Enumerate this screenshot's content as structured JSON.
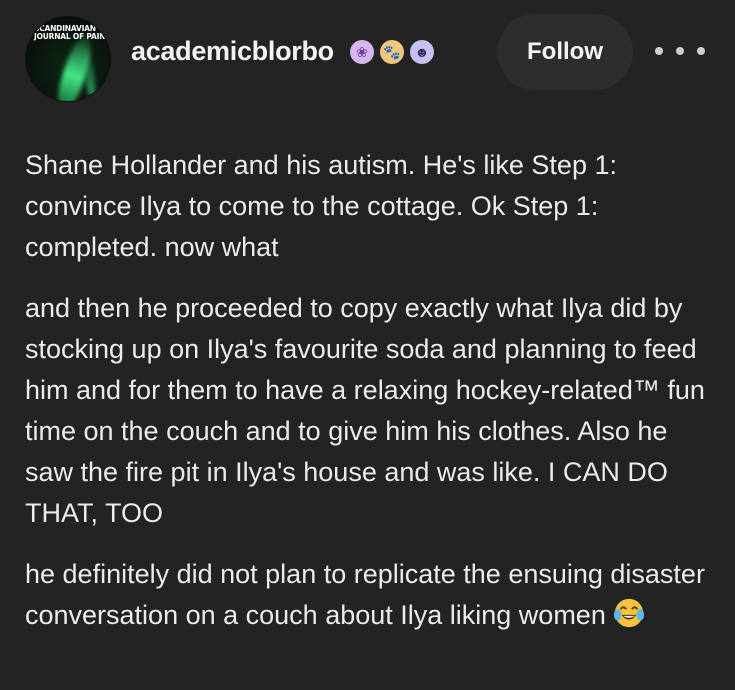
{
  "blog": {
    "avatar_text": "SCANDINAVIAN JOURNAL OF PAIN",
    "username": "academicblorbo",
    "badges": [
      {
        "icon": "brain-badge-icon",
        "glyph": "❀",
        "color": "#d7b5f2"
      },
      {
        "icon": "paw-badge-icon",
        "glyph": "🐾",
        "color": "#f2c57c"
      },
      {
        "icon": "ghost-badge-icon",
        "glyph": "☻",
        "color": "#c9bff2"
      }
    ],
    "follow_label": "Follow",
    "more_icon": "more-options-icon"
  },
  "post": {
    "paragraphs": [
      "Shane Hollander and his autism. He's like Step 1: convince Ilya to come to the cottage. Ok Step 1: completed. now what",
      "and then he proceeded to copy exactly what Ilya did by stocking up on Ilya's favourite soda and planning to feed him and for them to have a relaxing hockey-related™ fun time on the couch and to give him his clothes. Also he saw the fire pit in Ilya's house and was like. I CAN DO THAT, TOO",
      "he definitely did not plan to replicate the ensuing disaster conversation on a couch about Ilya liking women"
    ],
    "trailing_emoji": "tears-of-joy-emoji"
  }
}
